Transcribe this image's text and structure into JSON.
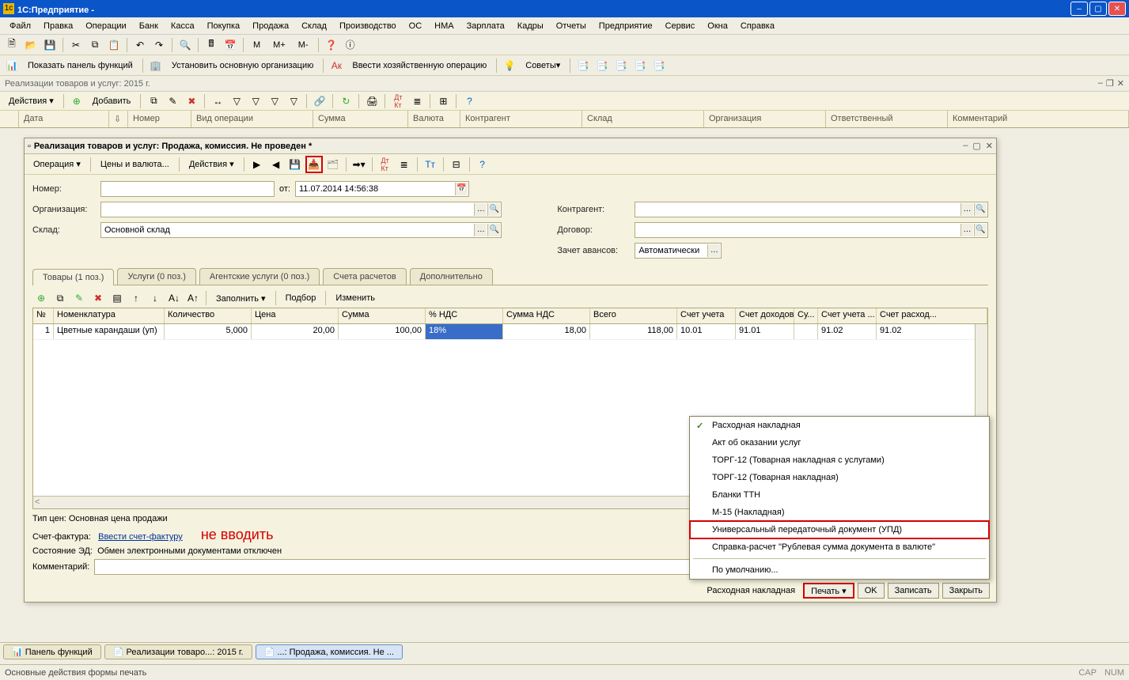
{
  "title_bar": {
    "app": "1С:Предприятие",
    "suffix": " - "
  },
  "menu": [
    "Файл",
    "Правка",
    "Операции",
    "Банк",
    "Касса",
    "Покупка",
    "Продажа",
    "Склад",
    "Производство",
    "ОС",
    "НМА",
    "Зарплата",
    "Кадры",
    "Отчеты",
    "Предприятие",
    "Сервис",
    "Окна",
    "Справка"
  ],
  "toolbar1_text": {
    "m": "M",
    "mplus": "M+",
    "mminus": "M-"
  },
  "toolbar2": {
    "show_panel": "Показать панель функций",
    "set_org": "Установить основную организацию",
    "enter_op": "Ввести хозяйственную операцию",
    "tips": "Советы"
  },
  "list_window": {
    "title": "Реализации товаров и услуг: 2015 г."
  },
  "list_toolbar": {
    "actions": "Действия ▾",
    "add": "Добавить"
  },
  "list_cols": [
    "",
    "Дата",
    "",
    "Номер",
    "Вид операции",
    "Сумма",
    "Валюта",
    "Контрагент",
    "Склад",
    "Организация",
    "Ответственный",
    "Комментарий"
  ],
  "doc": {
    "title": "Реализация товаров и услуг: Продажа, комиссия. Не проведен *",
    "toolbar": {
      "operation": "Операция ▾",
      "prices": "Цены и валюта...",
      "actions": "Действия ▾"
    },
    "fields": {
      "number_lbl": "Номер:",
      "number_val": "",
      "date_lbl": "от:",
      "date_val": "11.07.2014 14:56:38",
      "org_lbl": "Организация:",
      "org_val": "",
      "sklad_lbl": "Склад:",
      "sklad_val": "Основной склад",
      "kontr_lbl": "Контрагент:",
      "kontr_val": "",
      "dog_lbl": "Договор:",
      "dog_val": "",
      "avans_lbl": "Зачет авансов:",
      "avans_val": "Автоматически"
    },
    "tabs": [
      "Товары (1 поз.)",
      "Услуги (0 поз.)",
      "Агентские услуги (0 поз.)",
      "Счета расчетов",
      "Дополнительно"
    ],
    "tab_tb": {
      "fill": "Заполнить ▾",
      "pick": "Подбор",
      "edit": "Изменить"
    },
    "grid_cols": [
      "№",
      "Номенклатура",
      "Количество",
      "Цена",
      "Сумма",
      "% НДС",
      "Сумма НДС",
      "Всего",
      "Счет учета",
      "Счет доходов",
      "Су...",
      "Счет учета ...",
      "Счет расход..."
    ],
    "grid_row": {
      "n": "1",
      "nom": "Цветные карандаши (уп)",
      "qty": "5,000",
      "price": "20,00",
      "sum": "100,00",
      "vat": "18%",
      "vatsum": "18,00",
      "total": "118,00",
      "acc": "10.01",
      "accd": "91.01",
      "su": "",
      "accu": "91.02",
      "accr": "91.02"
    },
    "footer": {
      "tip_cen": "Тип цен: Основная цена продажи",
      "sf_lbl": "Счет-фактура:",
      "sf_link": "Ввести счет-фактуру",
      "red": "не вводить",
      "ed_lbl": "Состояние ЭД:",
      "ed_val": "Обмен электронными документами отключен",
      "comment_lbl": "Комментарий:",
      "left_btn_hint": "Расходная накладная",
      "print": "Печать ▾",
      "ok": "OK",
      "save": "Записать",
      "close": "Закрыть"
    },
    "print_menu": [
      {
        "label": "Расходная накладная",
        "check": true
      },
      {
        "label": "Акт об оказании услуг"
      },
      {
        "label": "ТОРГ-12 (Товарная накладная с услугами)"
      },
      {
        "label": "ТОРГ-12 (Товарная накладная)"
      },
      {
        "label": "Бланки ТТН"
      },
      {
        "label": "М-15 (Накладная)"
      },
      {
        "label": "Универсальный передаточный документ (УПД)",
        "hl": true
      },
      {
        "label": "Справка-расчет \"Рублевая сумма документа в валюте\""
      },
      {
        "sep": true
      },
      {
        "label": "По умолчанию..."
      }
    ]
  },
  "taskbar": {
    "panel": "Панель функций",
    "t1": "Реализации товаро...: 2015 г.",
    "t2": "...: Продажа, комиссия. Не ..."
  },
  "status": {
    "text": "Основные действия формы печать",
    "cap": "CAP",
    "num": "NUM"
  }
}
